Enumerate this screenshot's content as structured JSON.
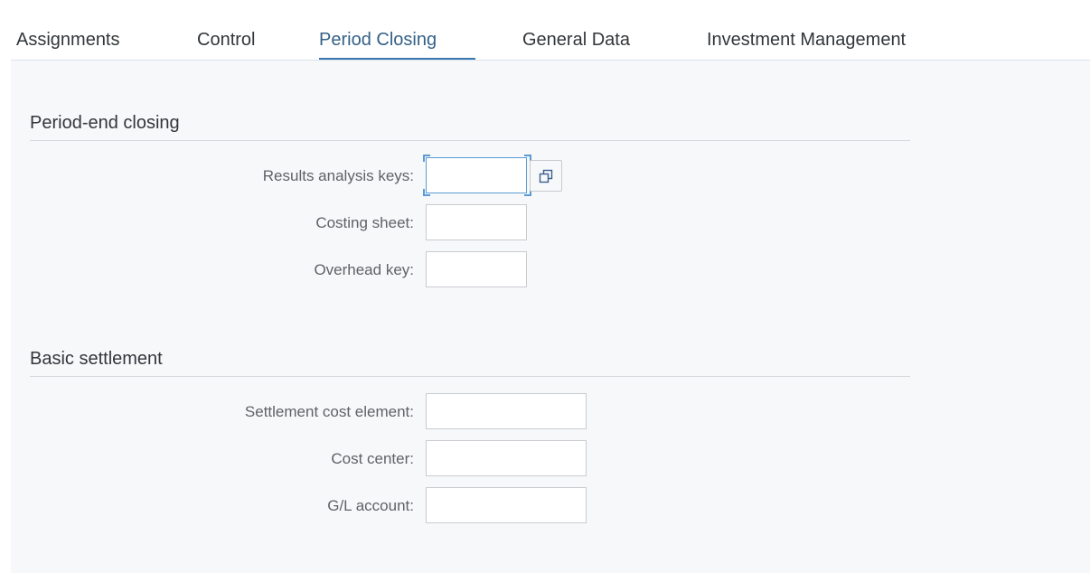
{
  "tabs": [
    {
      "label": "Assignments",
      "selected": false
    },
    {
      "label": "Control",
      "selected": false
    },
    {
      "label": "Period Closing",
      "selected": true
    },
    {
      "label": "General Data",
      "selected": false
    },
    {
      "label": "Investment Management",
      "selected": false
    }
  ],
  "period_end_closing": {
    "title": "Period-end closing",
    "fields": [
      {
        "label": "Results analysis keys:",
        "value": "",
        "focused": true,
        "value_help": true
      },
      {
        "label": "Costing sheet:",
        "value": ""
      },
      {
        "label": "Overhead key:",
        "value": ""
      }
    ]
  },
  "basic_settlement": {
    "title": "Basic settlement",
    "fields": [
      {
        "label": "Settlement cost element:",
        "value": ""
      },
      {
        "label": "Cost center:",
        "value": ""
      },
      {
        "label": "G/L account:",
        "value": ""
      }
    ]
  },
  "icons": {
    "value_help": "value-help-icon"
  },
  "colors": {
    "accent": "#3a77b0",
    "selected_tab_text": "#346187",
    "content_background": "#f7f8fa",
    "focus_border": "#5b9bd5"
  }
}
